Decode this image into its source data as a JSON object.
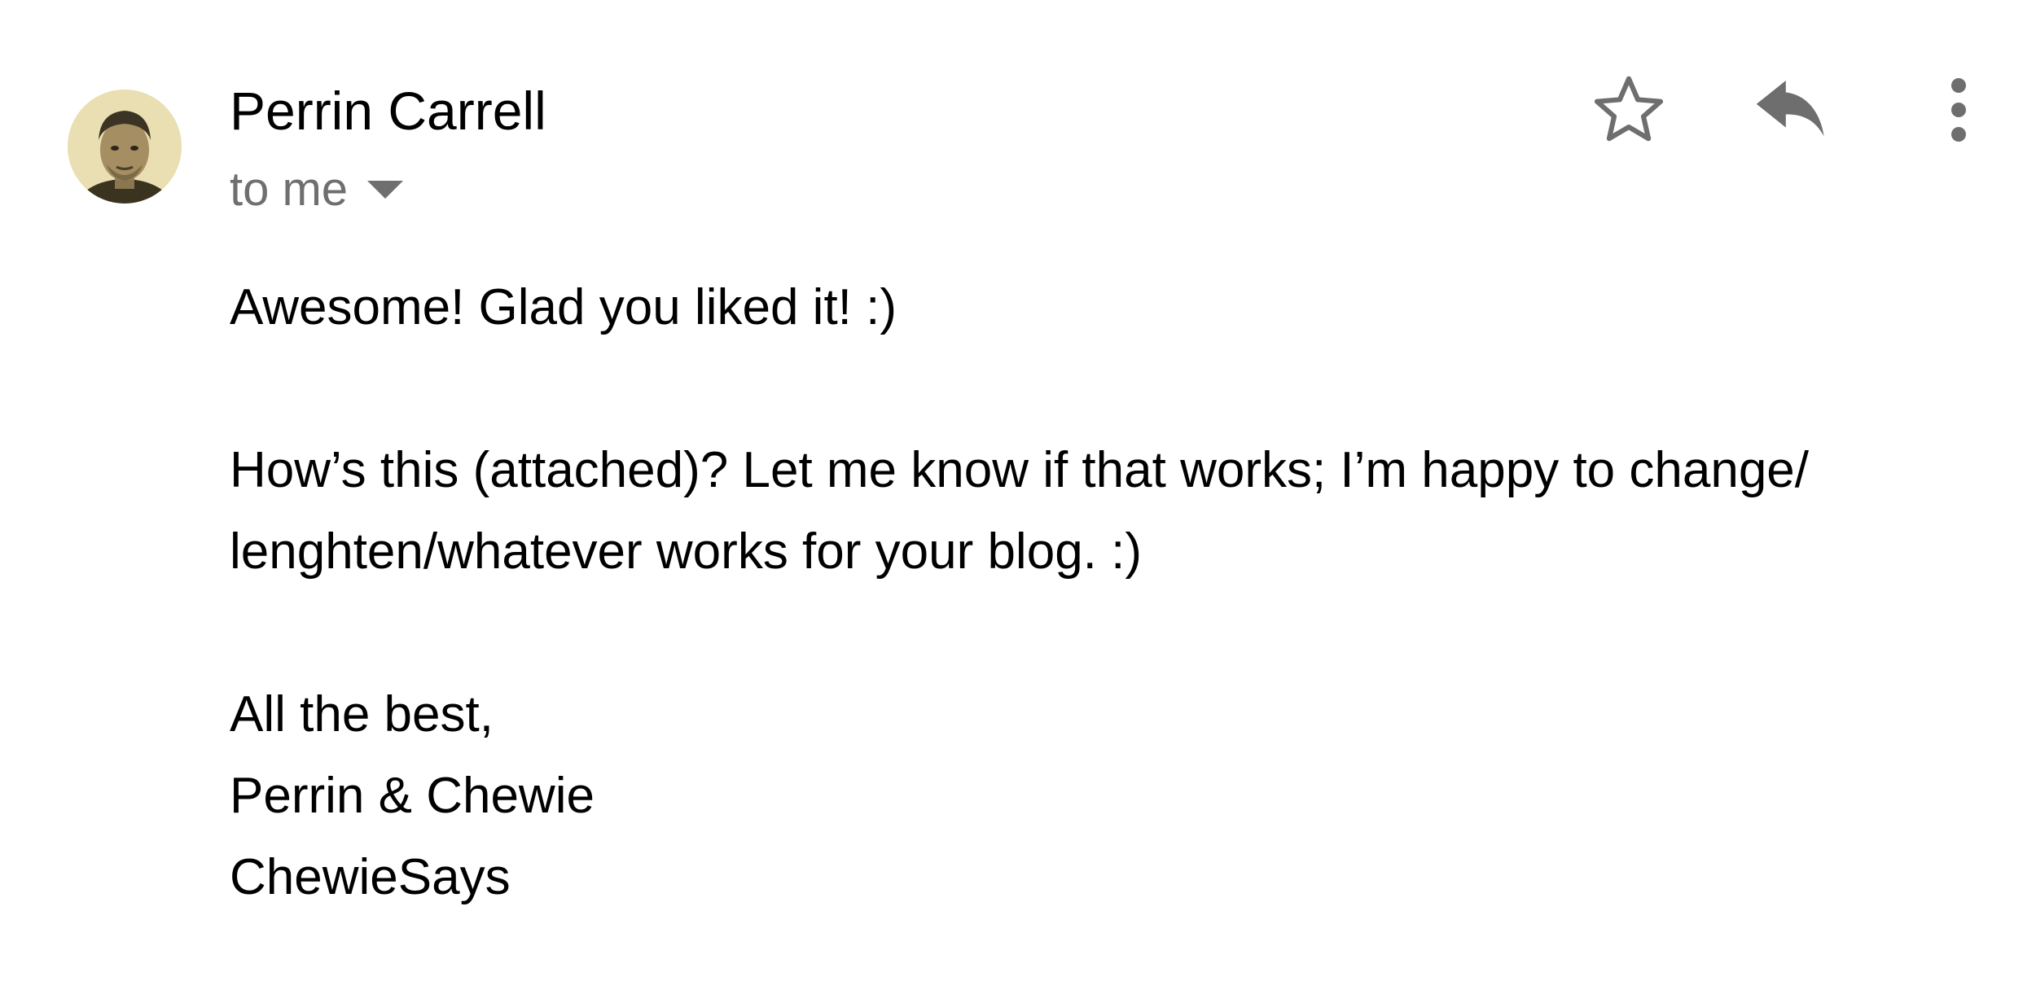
{
  "email": {
    "sender_name": "Perrin Carrell",
    "recipient_label": "to me",
    "body": {
      "greeting": "Awesome! Glad you liked it! :)",
      "paragraph_line_1": "How’s this (attached)? Let me know if that works; I’m happy to change/",
      "paragraph_line_2": "lenghten/whatever works for your blog. :)"
    },
    "signature": {
      "closing": "All the best,",
      "name": "Perrin & Chewie",
      "brand": "ChewieSays"
    }
  },
  "icons": {
    "avatar": "avatar-photo",
    "recipient_toggle": "caret-down-icon",
    "star": "star-outline-icon",
    "reply": "reply-icon",
    "more": "more-vert-icon"
  },
  "colors": {
    "primary_text": "#000000",
    "secondary_text": "#6f6f6f",
    "icon_gray": "#6e6e6e"
  }
}
